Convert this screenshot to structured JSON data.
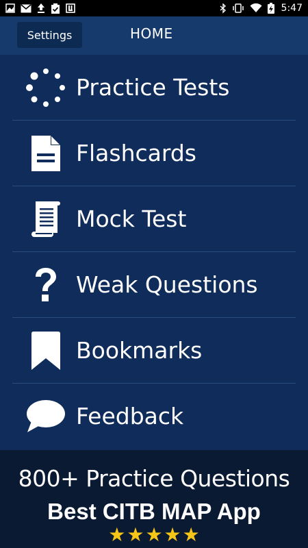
{
  "status_bar": {
    "time": "5:47",
    "left_icons": [
      "gallery-icon",
      "gmail-icon",
      "upload-icon",
      "clipboard-check-icon",
      "app-icon"
    ],
    "right_icons": [
      "bluetooth-icon",
      "vibrate-icon",
      "wifi-icon",
      "battery-charging-icon"
    ]
  },
  "app_bar": {
    "settings_label": "Settings",
    "title": "HOME"
  },
  "menu": {
    "items": [
      {
        "label": "Practice Tests",
        "icon": "loading-dots-icon"
      },
      {
        "label": "Flashcards",
        "icon": "document-icon"
      },
      {
        "label": "Mock Test",
        "icon": "scroll-icon"
      },
      {
        "label": "Weak Questions",
        "icon": "question-mark-icon"
      },
      {
        "label": "Bookmarks",
        "icon": "bookmark-icon"
      },
      {
        "label": "Feedback",
        "icon": "speech-bubble-icon"
      }
    ]
  },
  "promo": {
    "line1": "800+ Practice Questions",
    "line2": "Best CITB MAP App",
    "rating_stars": 5
  },
  "colors": {
    "background": "#0f2c5a",
    "app_bar": "#173a6c",
    "settings_button": "#0d2a52",
    "divider": "#2a4c7e",
    "promo_background": "#0b1a33",
    "star": "#f5c518"
  }
}
